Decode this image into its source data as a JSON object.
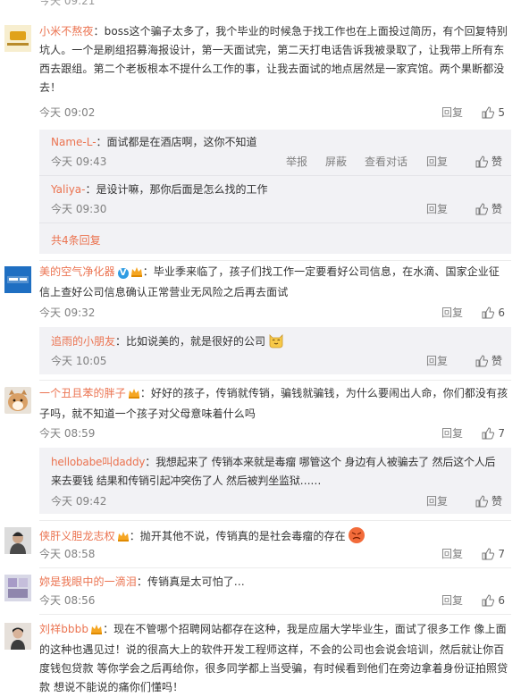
{
  "top_partial": "今天 09:21",
  "labels": {
    "reply": "回复",
    "report": "举报",
    "block": "屏蔽",
    "view_conversation": "查看对话",
    "like": "赞"
  },
  "comments": [
    {
      "user": "小米不熬夜",
      "text": "：boss这个骗子太多了，我个毕业的时候急于找工作也在上面投过简历，有个回复特别坑人。一个是刷组招募海报设计，第一天面试完，第二天打电话告诉我被录取了，让我带上所有东西去跟组。第二个老板根本不提什么工作的事，让我去面试的地点居然是一家宾馆。两个果断都没去！",
      "time": "今天 09:02",
      "likes": "5",
      "replies": [
        {
          "user": "Name-L-",
          "text": "：面试都是在酒店啊，这你不知道",
          "time": "今天 09:43"
        },
        {
          "user": "Yaliya-",
          "text": "：是设计嘛，那你后面是怎么找的工作",
          "time": "今天 09:30"
        }
      ],
      "more_replies": "共4条回复"
    },
    {
      "user": "美的空气净化器",
      "text": "：毕业季来临了，孩子们找工作一定要看好公司信息，在水滴、国家企业征信上查好公司信息确认正常营业无风险之后再去面试",
      "time": "今天 09:32",
      "likes": "6",
      "replies": [
        {
          "user": "追雨的小朋友",
          "text": "：比如说美的，就是很好的公司",
          "time": "今天 10:05"
        }
      ]
    },
    {
      "user": "一个丑且苯的胖子",
      "text": "：好好的孩子，传销就传销，骗钱就骗钱，为什么要闹出人命，你们都没有孩子吗，就不知道一个孩子对父母意味着什么吗",
      "time": "今天 08:59",
      "likes": "7",
      "replies": [
        {
          "user": "hellobabe叫daddy",
          "text": "：我想起来了 传销本来就是毒瘤 哪管这个 身边有人被骗去了 然后这个人后来去要钱 结果和传销引起冲突伤了人 然后被判坐监狱……",
          "time": "今天 09:42"
        }
      ]
    },
    {
      "user": "侠肝义胆龙志权",
      "text": "：抛开其他不说，传销真的是社会毒瘤的存在",
      "time": "今天 08:58",
      "likes": "7"
    },
    {
      "user": "妳是我眼中的一滴泪",
      "text": "：传销真是太可怕了…",
      "time": "今天 08:56",
      "likes": "6"
    },
    {
      "user": "刘祥bbbb",
      "text": "：现在不管哪个招聘网站都存在这种，我是应届大学毕业生，面试了很多工作 像上面的这种也遇见过！说的很高大上的软件开发工程师这样，不会的公司也会说会培训，然后就让你百度钱包贷款 等你学会之后再给你，很多同学都上当受骗，有时候看到他们在旁边拿着身份证拍照贷款 想说不能说的痛你们懂吗！"
    }
  ],
  "colors": {
    "username": "#eb7350",
    "reply_bg": "#f2f2f5",
    "meta": "#808080",
    "verified": "#2f9ce3"
  }
}
